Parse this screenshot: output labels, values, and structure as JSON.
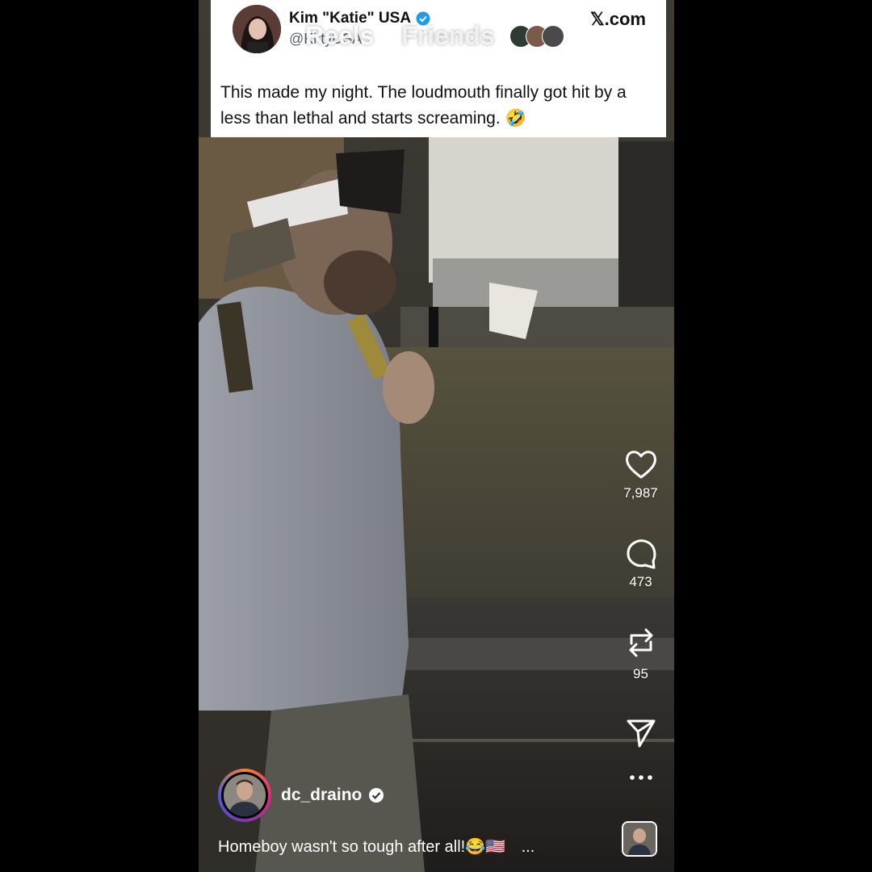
{
  "tweet": {
    "display_name": "Kim \"Katie\" USA",
    "handle": "@KittyUSA",
    "source": "𝕏.com",
    "text": "This made my night.  The loudmouth finally got hit by a less than lethal and starts screaming. 🤣"
  },
  "top_tabs": {
    "reels_label": "Reels",
    "friends_label": "Friends"
  },
  "actions": {
    "like_count": "7,987",
    "comment_count": "473",
    "repost_count": "95"
  },
  "icons": [
    "back-icon",
    "filter-icon",
    "heart-icon",
    "comment-icon",
    "repost-icon",
    "send-icon",
    "more-icon",
    "verified-icon"
  ],
  "author": {
    "username": "dc_draino"
  },
  "caption": {
    "text": "Homeboy wasn't so tough after all!😂🇺🇸",
    "more_label": "..."
  },
  "colors": {
    "background": "#000000",
    "tweet_bg": "#ffffff",
    "verified_blue": "#1d9bf0",
    "handle_gray": "#536471"
  }
}
